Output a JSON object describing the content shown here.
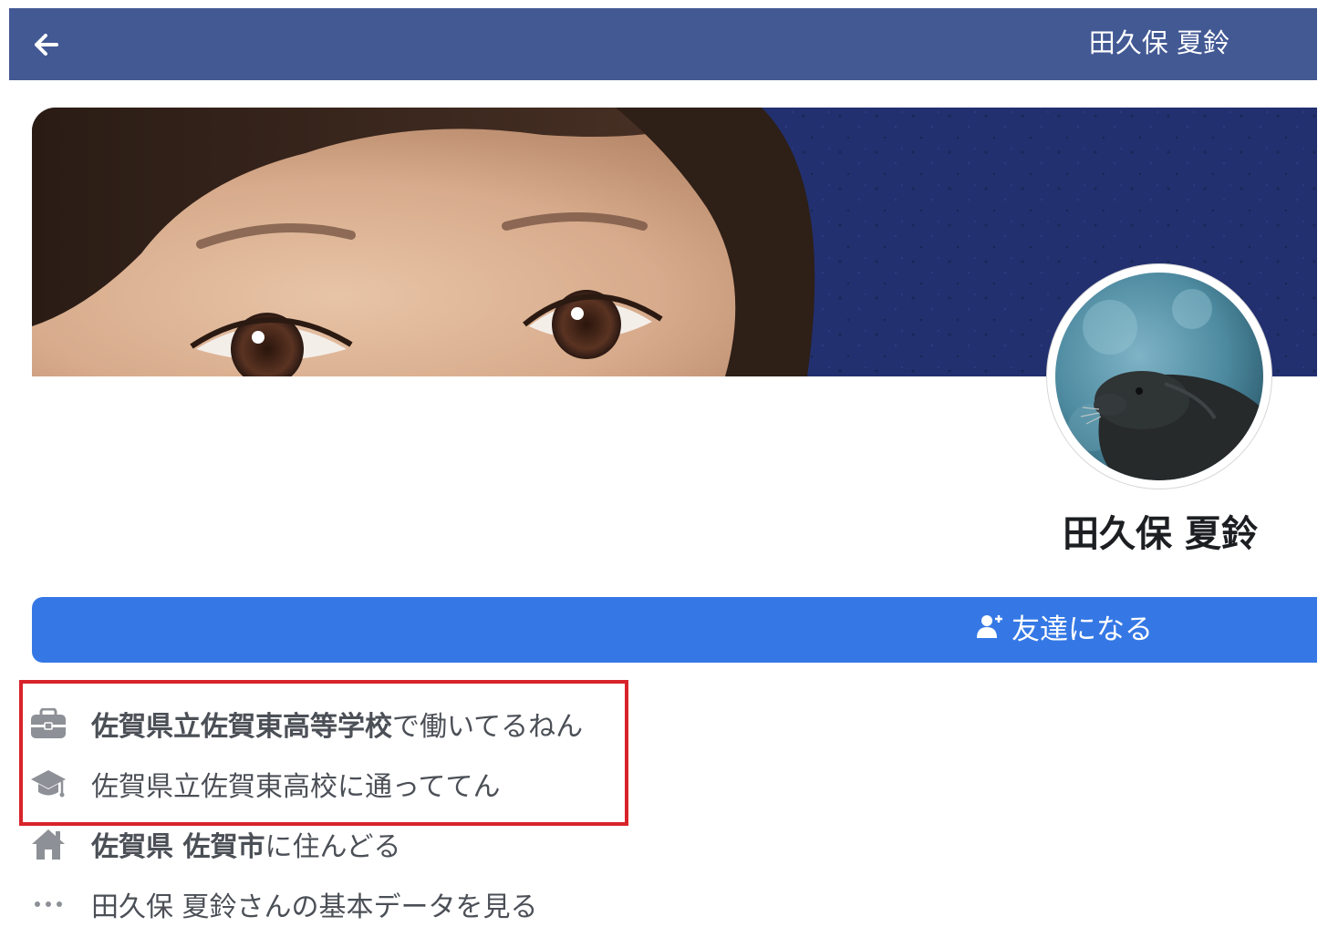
{
  "header": {
    "title": "田久保 夏鈴",
    "back_icon": "arrow-left-icon",
    "background": "#435994"
  },
  "profile": {
    "name": "田久保 夏鈴",
    "add_friend_label": "友達になる",
    "add_friend_icon": "person-add-icon",
    "button_color": "#3578e5"
  },
  "intro": {
    "work": {
      "icon": "briefcase-icon",
      "place": "佐賀県立佐賀東高等学校",
      "suffix": " で働いてるねん"
    },
    "education": {
      "icon": "graduation-cap-icon",
      "text": "佐賀県立佐賀東高校に通っててん"
    },
    "location": {
      "icon": "home-icon",
      "prefecture": "佐賀県",
      "city": "佐賀市",
      "suffix": "に住んどる"
    },
    "more": {
      "icon": "more-dots-icon",
      "text": "田久保 夏鈴さんの基本データを見る"
    },
    "highlight_color": "#d8232a"
  }
}
